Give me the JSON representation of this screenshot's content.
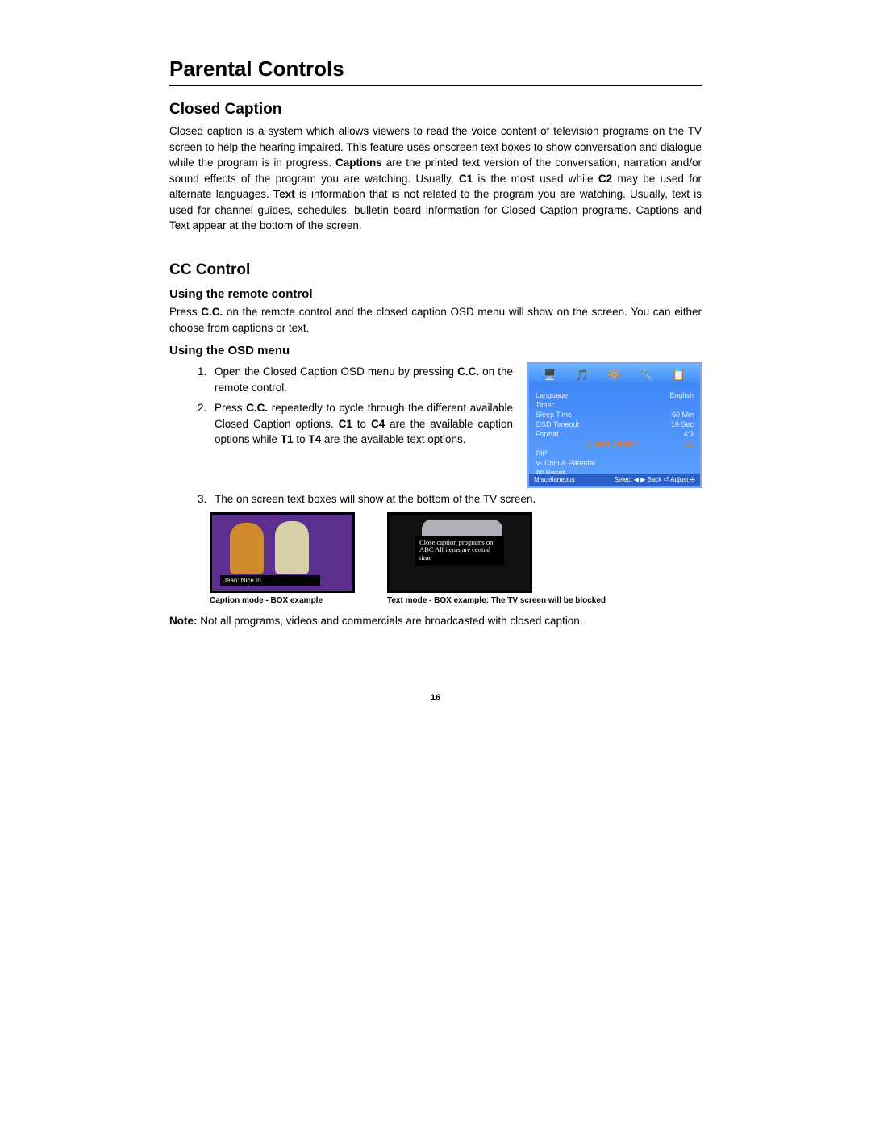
{
  "title": "Parental Controls",
  "sec1": {
    "heading": "Closed Caption",
    "p_before": "Closed caption is a system which allows viewers to read the voice content of television programs on the TV screen to help the hearing impaired. This feature uses onscreen text boxes to show conversation and dialogue while the program is in progress. ",
    "b1": "Captions",
    "p_after_b1": " are the printed text version of the conversation, narration and/or sound effects of the program you are watching. Usually, ",
    "b2": "C1",
    "p_after_b2": " is the most used while ",
    "b3": "C2",
    "p_after_b3": " may be used for alternate languages. ",
    "b4": "Text",
    "p_after_b4": " is information that is not related to the program you are watching. Usually, text is used for channel guides, schedules, bulletin board information for Closed Caption programs. Captions and Text appear at the bottom of the screen."
  },
  "sec2": {
    "heading": "CC Control",
    "sub1": "Using the remote control",
    "p1a": "Press ",
    "p1b": "C.C.",
    "p1c": " on the remote control and the closed caption OSD menu will show on the screen. You can either choose from captions or text.",
    "sub2": "Using the OSD menu",
    "li1a": "Open the Closed Caption OSD menu by pressing ",
    "li1b": "C.C.",
    "li1c": " on the remote control.",
    "li2a": "Press ",
    "li2b": "C.C.",
    "li2c": " repeatedly to cycle through the different available Closed Caption options. ",
    "li2d": "C1",
    "li2e": " to ",
    "li2f": "C4",
    "li2g": " are the available caption options while ",
    "li2h": "T1",
    "li2i": " to ",
    "li2j": "T4",
    "li2k": " are the available text options.",
    "li3": "The on screen text boxes will show at the bottom of the TV screen."
  },
  "osd": {
    "icons": [
      "🖥️",
      "🎵",
      "🔆",
      "🔧",
      "📋"
    ],
    "rows": [
      {
        "l": "Language",
        "r": "English",
        "sel": false
      },
      {
        "l": "Timer",
        "r": "",
        "sel": false
      },
      {
        "l": "Sleep Time",
        "r": "60 Min",
        "sel": false
      },
      {
        "l": "OSD Timeout",
        "r": "10 Sec",
        "sel": false
      },
      {
        "l": "Format",
        "r": "4:3",
        "sel": false
      },
      {
        "l": "Closed Caption",
        "r": "C1",
        "sel": true
      },
      {
        "l": "PIP",
        "r": "",
        "sel": false
      },
      {
        "l": "V- Chip & Parental",
        "r": "",
        "sel": false
      },
      {
        "l": "All Reset",
        "r": "",
        "sel": false
      }
    ],
    "footer_l": "Miscellaneous",
    "footer_r": "Select ◀ ▶  Back ⏎  Adjust ⎆"
  },
  "examples": {
    "cap_strip": "Jean: Nice to",
    "text_block": "Close caption programs on ABC\nAll items are central time",
    "label1": "Caption mode - BOX example",
    "label2": "Text mode - BOX example: The TV screen will be blocked"
  },
  "note_b": "Note:",
  "note": " Not all programs, videos and commercials are broadcasted with closed caption.",
  "page_number": "16"
}
